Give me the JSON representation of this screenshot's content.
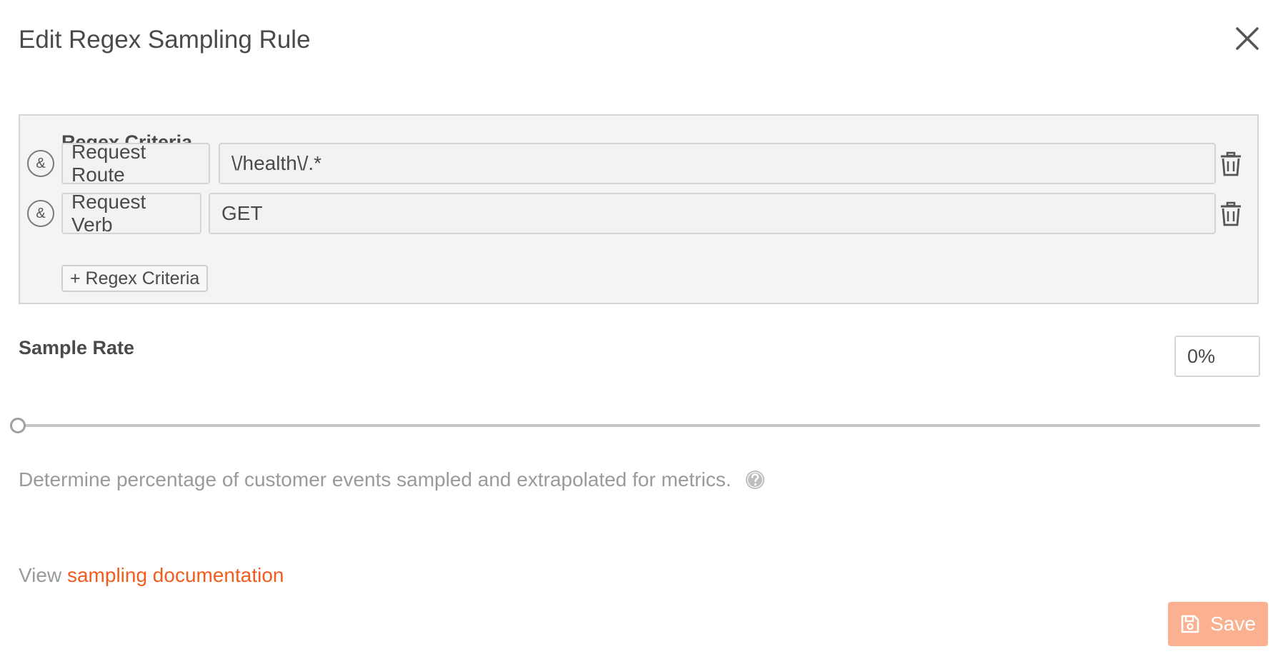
{
  "dialog": {
    "title": "Edit Regex Sampling Rule",
    "close_icon": "close-icon"
  },
  "regex_criteria": {
    "heading": "Regex Criteria",
    "rows": [
      {
        "connector": "&",
        "field": "Request Route",
        "value": "\\/health\\/.*"
      },
      {
        "connector": "&",
        "field": "Request Verb",
        "value": "GET"
      }
    ],
    "add_button_label": "+ Regex Criteria"
  },
  "sample_rate": {
    "label": "Sample Rate",
    "value": "0%",
    "slider_percent": 0,
    "help_text": "Determine percentage of customer events sampled and extrapolated for metrics.",
    "help_icon": "question-circle-icon"
  },
  "docs": {
    "prefix": "View",
    "link_text": "sampling documentation"
  },
  "actions": {
    "save_label": "Save",
    "save_icon": "floppy-disk-icon"
  },
  "colors": {
    "accent": "#f25c1d",
    "save_button_disabled": "#fbb08f",
    "panel_background": "#f4f4f4"
  }
}
